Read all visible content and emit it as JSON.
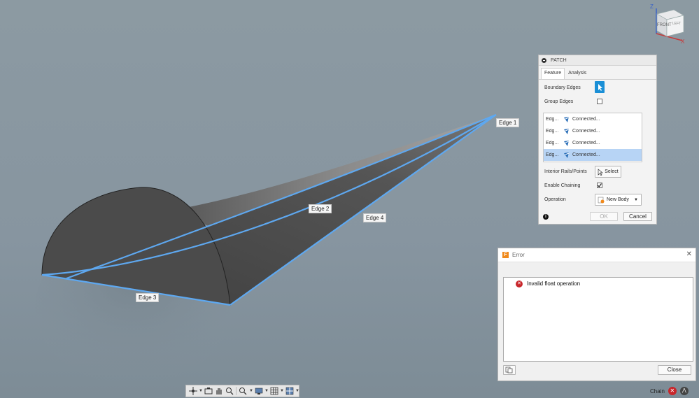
{
  "viewcube": {
    "face_label": "FRONT",
    "side_label": "LEFT",
    "axis_z": "Z",
    "axis_x": "X"
  },
  "edge_labels": {
    "edge1": "Edge 1",
    "edge2": "Edge 2",
    "edge3": "Edge 3",
    "edge4": "Edge 4"
  },
  "patch_panel": {
    "title": "PATCH",
    "tabs": [
      {
        "label": "Feature",
        "active": true
      },
      {
        "label": "Analysis",
        "active": false
      }
    ],
    "boundary_edges_label": "Boundary Edges",
    "group_edges_label": "Group Edges",
    "group_edges_checked": false,
    "edge_rows": [
      {
        "name": "Edg...",
        "chain": "Connected...",
        "selected": false
      },
      {
        "name": "Edg...",
        "chain": "Connected...",
        "selected": false
      },
      {
        "name": "Edg...",
        "chain": "Connected...",
        "selected": false
      },
      {
        "name": "Edg...",
        "chain": "Connected...",
        "selected": true
      }
    ],
    "interior_rails_label": "Interior Rails/Points",
    "select_label": "Select",
    "enable_chaining_label": "Enable Chaining",
    "enable_chaining_checked": true,
    "operation_label": "Operation",
    "operation_value": "New Body",
    "ok_label": "OK",
    "cancel_label": "Cancel"
  },
  "error_dialog": {
    "title": "Error",
    "app_icon_letter": "F",
    "message": "Invalid float operation",
    "close_label": "Close"
  },
  "status_bar": {
    "mode": "Chain"
  },
  "colors": {
    "accent": "#1a8fd6",
    "edge_highlight": "#5ea8f0",
    "error_red": "#c8262b",
    "selection": "#b7d4f5"
  }
}
